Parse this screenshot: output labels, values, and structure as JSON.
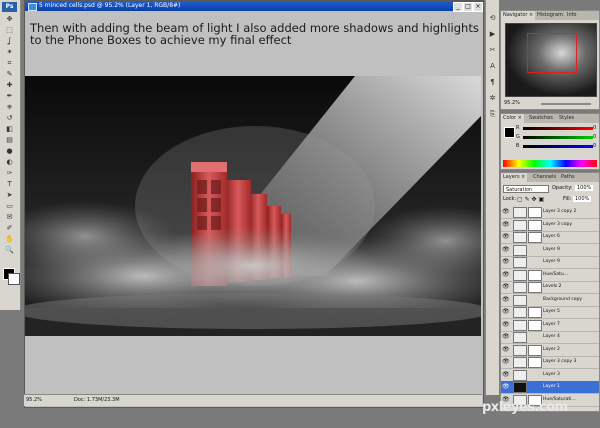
{
  "app": {
    "logo": "Ps"
  },
  "document": {
    "title": "5 minced cells.psd @ 95.2% (Layer 1, RGB/8#)",
    "zoom": "95.2%",
    "doc_size": "Doc: 1.73M/23.3M",
    "caption": "Then with adding the beam of light I also added more shadows and highlights to the Phone Boxes to achieve my final effect",
    "window_buttons": [
      "_",
      "□",
      "×"
    ]
  },
  "toolbox": {
    "tools": [
      "move-icon",
      "marquee-icon",
      "lasso-icon",
      "magic-wand-icon",
      "crop-icon",
      "slice-icon",
      "healing-icon",
      "brush-icon",
      "stamp-icon",
      "history-brush-icon",
      "eraser-icon",
      "gradient-icon",
      "blur-icon",
      "dodge-icon",
      "pen-icon",
      "type-icon",
      "path-select-icon",
      "shape-icon",
      "notes-icon",
      "eyedropper-icon",
      "hand-icon",
      "zoom-icon"
    ],
    "glyphs": [
      "✥",
      "⬚",
      "ʆ",
      "✶",
      "⌗",
      "✎",
      "✚",
      "✒",
      "⎈",
      "↺",
      "◧",
      "▤",
      "●",
      "◐",
      "✑",
      "T",
      "➤",
      "▭",
      "✉",
      "✐",
      "✋",
      "🔍"
    ]
  },
  "dock": {
    "icons": [
      "history-icon",
      "actions-icon",
      "tool-presets-icon",
      "character-icon",
      "paragraph-icon",
      "brushes-icon",
      "clone-source-icon"
    ],
    "glyphs": [
      "⟲",
      "▶",
      "✂",
      "A",
      "¶",
      "✲",
      "⎘"
    ]
  },
  "navigator": {
    "tabs": [
      "Navigator ×",
      "Histogram",
      "Info"
    ],
    "zoom": "95.2%"
  },
  "color_panel": {
    "tabs": [
      "Color ×",
      "Swatches",
      "Styles"
    ],
    "channels": [
      {
        "label": "R",
        "value": "0"
      },
      {
        "label": "G",
        "value": "0"
      },
      {
        "label": "B",
        "value": "0"
      }
    ]
  },
  "layers_panel": {
    "tabs": [
      "Layers ×",
      "Channels",
      "Paths"
    ],
    "blend_mode": "Saturation",
    "opacity_label": "Opacity:",
    "opacity": "100%",
    "lock_label": "Lock:",
    "fill_label": "Fill:",
    "fill": "100%",
    "layers": [
      {
        "name": "Layer 3 copy 2",
        "mask": true,
        "selected": false
      },
      {
        "name": "Layer 3 copy",
        "mask": true,
        "selected": false
      },
      {
        "name": "Layer 6",
        "mask": true,
        "selected": false
      },
      {
        "name": "Layer 9",
        "mask": false,
        "selected": false
      },
      {
        "name": "Layer 9",
        "mask": false,
        "selected": false
      },
      {
        "name": "Hue/Satu...",
        "mask": true,
        "selected": false
      },
      {
        "name": "Levels 2",
        "mask": true,
        "selected": false
      },
      {
        "name": "Background copy",
        "mask": false,
        "selected": false
      },
      {
        "name": "Layer 5",
        "mask": true,
        "selected": false
      },
      {
        "name": "Layer 7",
        "mask": true,
        "selected": false
      },
      {
        "name": "Layer 4",
        "mask": false,
        "selected": false
      },
      {
        "name": "Layer 2",
        "mask": true,
        "selected": false
      },
      {
        "name": "Layer 3 copy 3",
        "mask": true,
        "selected": false
      },
      {
        "name": "Layer 3",
        "mask": false,
        "selected": false
      },
      {
        "name": "Layer 1",
        "mask": false,
        "selected": true
      },
      {
        "name": "Hue/Saturati...",
        "mask": true,
        "selected": false
      }
    ]
  },
  "watermark": "pxleyes.com",
  "colors": {
    "selection": "#3b6fd4",
    "titlebar": "#1f5fd0",
    "phonebox": "#c03030"
  }
}
